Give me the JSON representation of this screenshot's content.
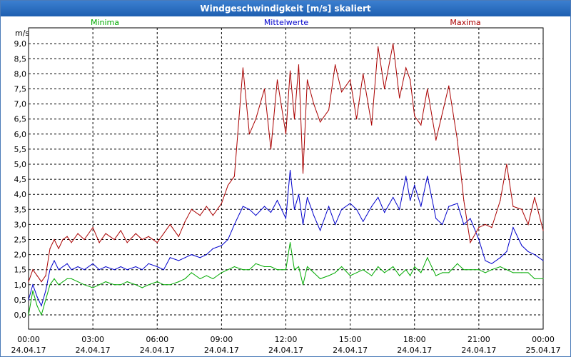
{
  "window": {
    "title": "Windgeschwindigkeit [m/s] skaliert"
  },
  "colors": {
    "minima": "#00aa00",
    "mittelwerte": "#0000cc",
    "maxima": "#aa0000",
    "titlebar": "#2b6cc0"
  },
  "chart_data": {
    "type": "line",
    "title": "Windgeschwindigkeit [m/s] skaliert",
    "ylabel": "m/s",
    "xlabel": "",
    "ylim": [
      0,
      9.5
    ],
    "xlim_hours": [
      0,
      24
    ],
    "y_ticks": [
      "0,0",
      "0,5",
      "1,0",
      "1,5",
      "2,0",
      "2,5",
      "3,0",
      "3,5",
      "4,0",
      "4,5",
      "5,0",
      "5,5",
      "6,0",
      "6,5",
      "7,0",
      "7,5",
      "8,0",
      "8,5",
      "9,0"
    ],
    "x_ticks": [
      {
        "time": "00:00",
        "date": "24.04.17"
      },
      {
        "time": "03:00",
        "date": "24.04.17"
      },
      {
        "time": "06:00",
        "date": "24.04.17"
      },
      {
        "time": "09:00",
        "date": "24.04.17"
      },
      {
        "time": "12:00",
        "date": "24.04.17"
      },
      {
        "time": "15:00",
        "date": "24.04.17"
      },
      {
        "time": "18:00",
        "date": "24.04.17"
      },
      {
        "time": "21:00",
        "date": "24.04.17"
      },
      {
        "time": "00:00",
        "date": "25.04.17"
      }
    ],
    "grid": true,
    "legend_placement": "top",
    "series": [
      {
        "name": "Minima",
        "x_hours": [
          0,
          0.2,
          0.4,
          0.6,
          0.8,
          1.0,
          1.2,
          1.4,
          1.6,
          1.8,
          2.0,
          2.3,
          2.6,
          3.0,
          3.3,
          3.6,
          4.0,
          4.3,
          4.6,
          5.0,
          5.3,
          5.6,
          6.0,
          6.3,
          6.6,
          7.0,
          7.3,
          7.6,
          8.0,
          8.3,
          8.6,
          9.0,
          9.3,
          9.6,
          10.0,
          10.3,
          10.6,
          11.0,
          11.3,
          11.6,
          12.0,
          12.2,
          12.4,
          12.6,
          12.8,
          13.0,
          13.3,
          13.6,
          14.0,
          14.3,
          14.6,
          15.0,
          15.3,
          15.6,
          16.0,
          16.3,
          16.6,
          17.0,
          17.3,
          17.6,
          17.8,
          18.0,
          18.3,
          18.6,
          19.0,
          19.3,
          19.6,
          20.0,
          20.3,
          20.6,
          21.0,
          21.3,
          21.6,
          22.0,
          22.3,
          22.6,
          23.0,
          23.3,
          23.6,
          24.0
        ],
        "values": [
          0.0,
          0.8,
          0.3,
          0.0,
          0.5,
          1.0,
          1.2,
          1.0,
          1.1,
          1.2,
          1.2,
          1.1,
          1.0,
          0.9,
          1.0,
          1.1,
          1.0,
          1.0,
          1.1,
          1.0,
          0.9,
          1.0,
          1.1,
          1.0,
          1.0,
          1.1,
          1.2,
          1.4,
          1.2,
          1.3,
          1.2,
          1.4,
          1.5,
          1.6,
          1.5,
          1.5,
          1.7,
          1.6,
          1.6,
          1.5,
          1.5,
          2.4,
          1.5,
          1.6,
          1.0,
          1.6,
          1.4,
          1.2,
          1.3,
          1.4,
          1.6,
          1.3,
          1.4,
          1.5,
          1.3,
          1.6,
          1.4,
          1.6,
          1.3,
          1.5,
          1.3,
          1.6,
          1.4,
          1.9,
          1.3,
          1.4,
          1.4,
          1.7,
          1.5,
          1.5,
          1.5,
          1.4,
          1.5,
          1.6,
          1.5,
          1.4,
          1.4,
          1.4,
          1.2,
          1.2
        ]
      },
      {
        "name": "Mittelwerte",
        "x_hours": [
          0,
          0.2,
          0.4,
          0.6,
          0.8,
          1.0,
          1.2,
          1.4,
          1.6,
          1.8,
          2.0,
          2.3,
          2.6,
          3.0,
          3.3,
          3.6,
          4.0,
          4.3,
          4.6,
          5.0,
          5.3,
          5.6,
          6.0,
          6.3,
          6.6,
          7.0,
          7.3,
          7.6,
          8.0,
          8.3,
          8.6,
          9.0,
          9.3,
          9.6,
          10.0,
          10.3,
          10.6,
          11.0,
          11.3,
          11.6,
          12.0,
          12.2,
          12.4,
          12.6,
          12.8,
          13.0,
          13.3,
          13.6,
          14.0,
          14.3,
          14.6,
          15.0,
          15.3,
          15.6,
          16.0,
          16.3,
          16.6,
          17.0,
          17.3,
          17.6,
          17.8,
          18.0,
          18.3,
          18.6,
          19.0,
          19.3,
          19.6,
          20.0,
          20.3,
          20.6,
          21.0,
          21.3,
          21.6,
          22.0,
          22.3,
          22.6,
          23.0,
          23.3,
          23.6,
          24.0
        ],
        "values": [
          0.5,
          1.0,
          0.6,
          0.3,
          0.8,
          1.5,
          1.8,
          1.5,
          1.6,
          1.7,
          1.5,
          1.6,
          1.5,
          1.7,
          1.5,
          1.6,
          1.5,
          1.6,
          1.5,
          1.6,
          1.5,
          1.7,
          1.6,
          1.5,
          1.9,
          1.8,
          1.9,
          2.0,
          1.9,
          2.0,
          2.2,
          2.3,
          2.5,
          3.0,
          3.6,
          3.5,
          3.3,
          3.6,
          3.4,
          3.8,
          3.2,
          4.8,
          3.5,
          4.0,
          3.0,
          3.9,
          3.3,
          2.8,
          3.6,
          3.0,
          3.5,
          3.7,
          3.5,
          3.1,
          3.6,
          3.9,
          3.4,
          3.9,
          3.5,
          4.6,
          3.8,
          4.3,
          3.6,
          4.6,
          3.2,
          3.0,
          3.6,
          3.7,
          3.0,
          3.2,
          2.5,
          1.8,
          1.7,
          1.9,
          2.1,
          2.9,
          2.3,
          2.1,
          2.0,
          1.8
        ]
      },
      {
        "name": "Maxima",
        "x_hours": [
          0,
          0.2,
          0.4,
          0.6,
          0.8,
          1.0,
          1.2,
          1.4,
          1.6,
          1.8,
          2.0,
          2.3,
          2.6,
          3.0,
          3.3,
          3.6,
          4.0,
          4.3,
          4.6,
          5.0,
          5.3,
          5.6,
          6.0,
          6.3,
          6.6,
          7.0,
          7.3,
          7.6,
          8.0,
          8.3,
          8.6,
          9.0,
          9.3,
          9.6,
          10.0,
          10.3,
          10.6,
          11.0,
          11.3,
          11.6,
          12.0,
          12.2,
          12.4,
          12.6,
          12.8,
          13.0,
          13.3,
          13.6,
          14.0,
          14.3,
          14.6,
          15.0,
          15.3,
          15.6,
          16.0,
          16.3,
          16.6,
          17.0,
          17.3,
          17.6,
          17.8,
          18.0,
          18.3,
          18.6,
          19.0,
          19.3,
          19.6,
          20.0,
          20.3,
          20.6,
          21.0,
          21.3,
          21.6,
          22.0,
          22.3,
          22.6,
          23.0,
          23.3,
          23.6,
          24.0
        ],
        "values": [
          1.1,
          1.5,
          1.3,
          1.1,
          1.3,
          2.2,
          2.5,
          2.2,
          2.5,
          2.6,
          2.4,
          2.7,
          2.5,
          2.9,
          2.4,
          2.7,
          2.5,
          2.8,
          2.4,
          2.7,
          2.5,
          2.6,
          2.4,
          2.7,
          3.0,
          2.6,
          3.1,
          3.5,
          3.3,
          3.6,
          3.3,
          3.7,
          4.3,
          4.6,
          8.2,
          6.0,
          6.5,
          7.5,
          5.5,
          7.8,
          6.0,
          8.1,
          6.5,
          8.3,
          4.7,
          7.8,
          7.0,
          6.4,
          6.8,
          8.3,
          7.4,
          7.8,
          6.5,
          8.0,
          6.3,
          8.9,
          7.5,
          9.0,
          7.2,
          8.2,
          7.8,
          6.6,
          6.3,
          7.5,
          5.8,
          6.7,
          7.6,
          5.8,
          3.8,
          2.4,
          2.9,
          3.0,
          2.9,
          3.8,
          5.0,
          3.6,
          3.5,
          3.0,
          3.9,
          2.8
        ]
      }
    ]
  }
}
